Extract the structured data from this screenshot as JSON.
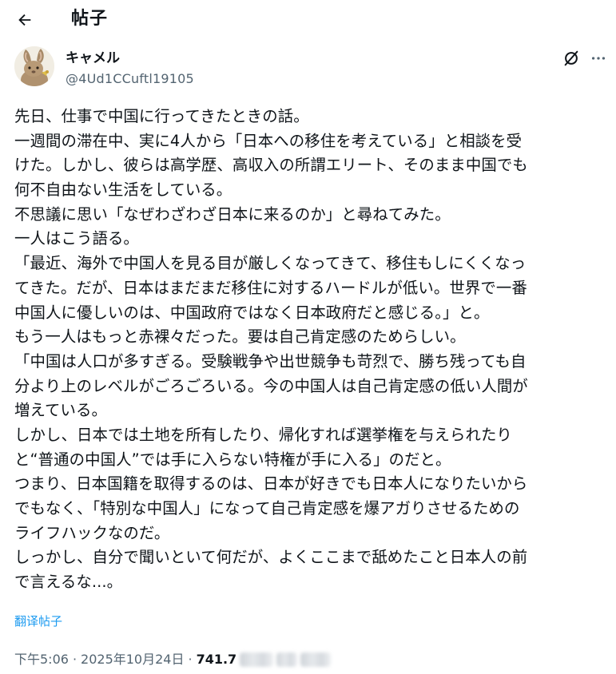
{
  "header": {
    "back_icon": "arrow-left-icon",
    "title": "帖子"
  },
  "author": {
    "avatar_icon": "rabbit-avatar",
    "display_name": "キャメル",
    "handle": "@4Ud1CCuftl19105"
  },
  "actions": {
    "grok_icon": "grok-icon",
    "more_icon": "more-horizontal-icon"
  },
  "post": {
    "lines": [
      "先日、仕事で中国に行ってきたときの話。",
      "一週間の滞在中、実に4人から「日本への移住を考えている」と相談を受",
      "けた。しかし、彼らは高学歴、高収入の所謂エリート、そのまま中国でも",
      "何不自由ない生活をしている。",
      "不思議に思い「なぜわざわざ日本に来るのか」と尋ねてみた。",
      "一人はこう語る。",
      "「最近、海外で中国人を見る目が厳しくなってきて、移住もしにくくなっ",
      "てきた。だが、日本はまだまだ移住に対するハードルが低い。世界で一番",
      "中国人に優しいのは、中国政府ではなく日本政府だと感じる。」と。",
      "もう一人はもっと赤裸々だった。要は自己肯定感のためらしい。",
      "「中国は人口が多すぎる。受験戦争や出世競争も苛烈で、勝ち残っても自",
      "分より上のレベルがごろごろいる。今の中国人は自己肯定感の低い人間が",
      "増えている。",
      "しかし、日本では土地を所有したり、帰化すれば選挙権を与えられたり",
      "と“普通の中国人”では手に入らない特権が手に入る」のだと。",
      "つまり、日本国籍を取得するのは、日本が好きでも日本人になりたいから",
      "でもなく、「特別な中国人」になって自己肯定感を爆アガりさせるための",
      "ライフハックなのだ。",
      "しっかし、自分で聞いといて何だが、よくここまで舐めたこと日本人の前",
      "で言えるな...。"
    ],
    "translate_label": "翻译帖子"
  },
  "meta": {
    "time": "下午5:06",
    "separator": "·",
    "date": "2025年10月24日",
    "views_visible": "741.7"
  },
  "colors": {
    "text": "#0f1419",
    "secondary": "#536471",
    "link": "#1d9bf0"
  }
}
